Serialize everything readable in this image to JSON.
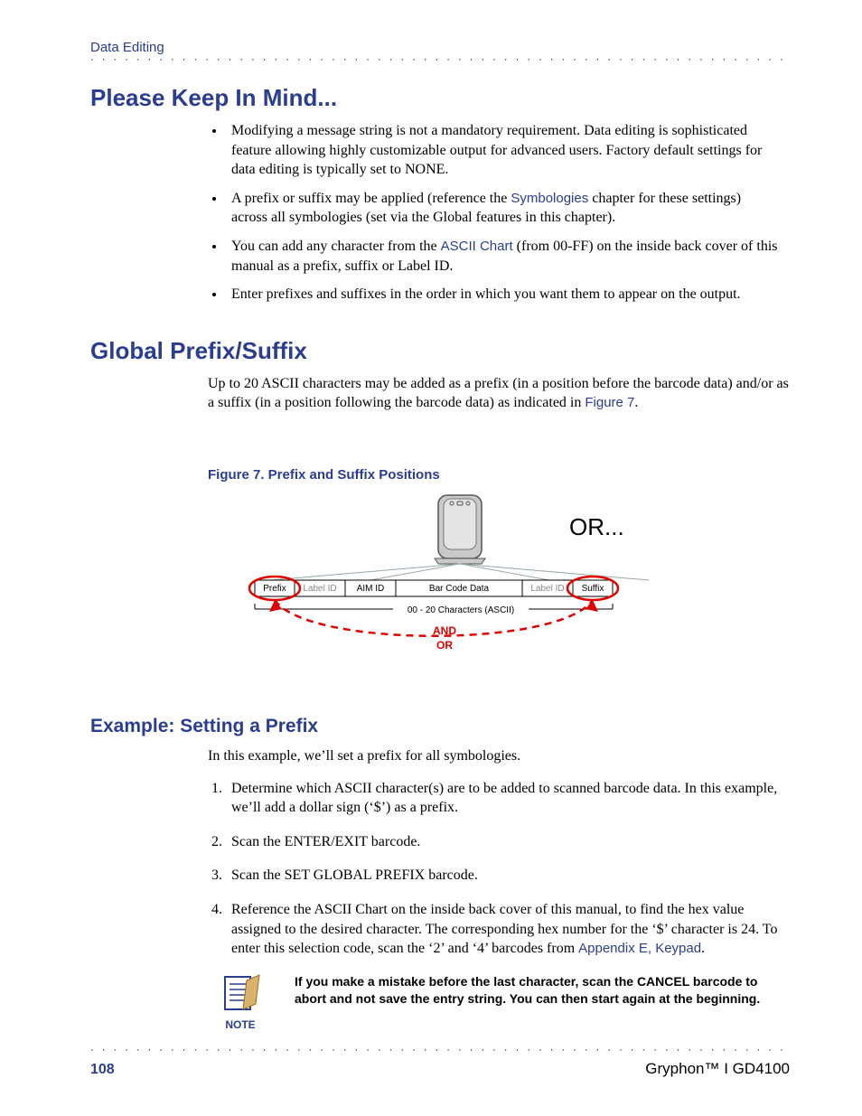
{
  "runningHead": "Data Editing",
  "sections": {
    "mind": {
      "title": "Please Keep In Mind...",
      "bullets": {
        "b1": "Modifying a message string is not a mandatory requirement. Data editing is sophisticated feature allowing highly customizable output for advanced users. Factory default settings for data editing is typically set to NONE.",
        "b2a": "A prefix or suffix may be applied (reference the ",
        "b2_link": "Symbologies",
        "b2b": " chapter for these settings) across all symbologies (set via the Global features in this chapter).",
        "b3a": "You can add any character from the ",
        "b3_link": "ASCII Chart",
        "b3b": " (from 00-FF) on the inside back cover of this manual as a prefix, suffix or Label ID.",
        "b4": "Enter prefixes and suffixes in the order in which you want them to appear on the output."
      }
    },
    "global": {
      "title": "Global Prefix/Suffix",
      "para_a": "Up to 20 ASCII characters may be added as a prefix (in a position before the barcode data) and/or as a suffix (in a position following the barcode data) as indicated in ",
      "para_link": "Figure 7",
      "para_b": "."
    },
    "figure": {
      "title": "Figure 7. Prefix and Suffix Positions",
      "or": "OR...",
      "prefix": "Prefix",
      "label_id": "Label ID",
      "aim_id": "AIM ID",
      "bar_code": "Bar Code Data",
      "suffix": "Suffix",
      "chars": "00 - 20 Characters (ASCII)",
      "and": "AND",
      "or2": "OR"
    },
    "example": {
      "title": "Example: Setting a Prefix",
      "intro": "In this example, we’ll set a prefix for all symbologies.",
      "steps": {
        "s1": "Determine which ASCII character(s) are to be added to scanned barcode data. In this example, we’ll add a dollar sign (‘$’) as a prefix.",
        "s2": "Scan the ENTER/EXIT barcode.",
        "s3": "Scan the SET GLOBAL PREFIX barcode.",
        "s4a": "Reference the ASCII Chart on the inside back cover of this manual, to find the hex value assigned to the desired character. The corresponding hex number for the ‘$’ character is 24. To enter this selection code, scan the ‘2’ and ‘4’ barcodes from ",
        "s4_link": "Appendix E, Keypad",
        "s4b": "."
      }
    },
    "note": {
      "label": "NOTE",
      "text": "If you make a mistake before the last character, scan the CANCEL barcode to abort and not save the entry string. You can then start again at the beginning."
    }
  },
  "footer": {
    "page": "108",
    "product": "Gryphon™ I GD4100"
  }
}
